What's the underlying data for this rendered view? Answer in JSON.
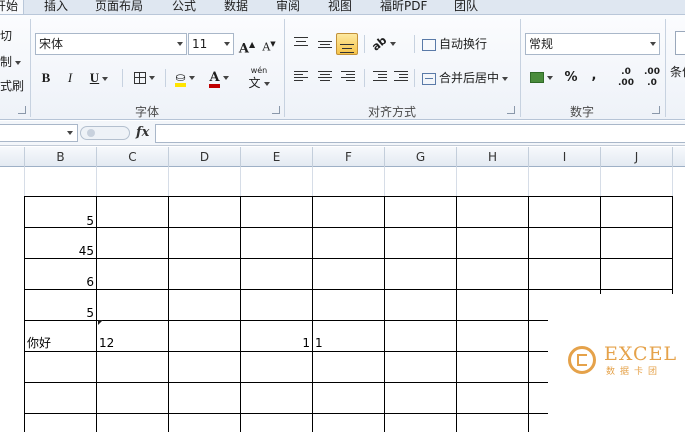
{
  "tabs": [
    "开始",
    "插入",
    "页面布局",
    "公式",
    "数据",
    "审阅",
    "视图",
    "福昕PDF",
    "团队"
  ],
  "clipboard": {
    "cut": "切",
    "copy": "制",
    "painter": "式刷"
  },
  "font": {
    "group_label": "字体",
    "name": "宋体",
    "size": "11",
    "grow": "A",
    "shrink": "A",
    "bold": "B",
    "italic": "I",
    "underline": "U",
    "font_color": "A",
    "phonetic": "wén"
  },
  "alignment": {
    "group_label": "对齐方式",
    "wrap_text": "自动换行",
    "merge_center": "合并后居中"
  },
  "number": {
    "group_label": "数字",
    "format": "常规",
    "percent": "%",
    "comma": ",",
    "inc_decimal": ".0",
    "inc_decimal_2": ".00",
    "dec_decimal": ".00",
    "dec_decimal_2": ".0"
  },
  "styles": {
    "conditional": "条件"
  },
  "formula_bar": {
    "fx": "fx",
    "value": ""
  },
  "columns": [
    "B",
    "C",
    "D",
    "E",
    "F",
    "G",
    "H",
    "I",
    "J"
  ],
  "cells": {
    "B1": "5",
    "B2": "45",
    "B3": "6",
    "B4": "5",
    "B5": "你好",
    "C5": "12",
    "E5": "1",
    "F5": "1"
  },
  "watermark": {
    "title": "EXCEL",
    "subtitle": "数据卡团"
  },
  "colors": {
    "ribbon_bg": "#eef2f8",
    "highlight": "#f5c34a",
    "fill_yellow": "#ffe400",
    "font_red": "#c00000",
    "watermark": "#e5a24a"
  }
}
